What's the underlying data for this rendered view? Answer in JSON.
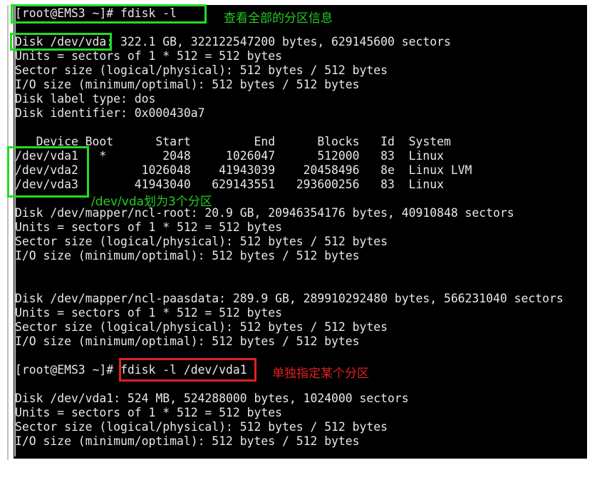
{
  "lines": [
    "[root@EMS3 ~]# fdisk -l",
    "",
    "Disk /dev/vda: 322.1 GB, 322122547200 bytes, 629145600 sectors",
    "Units = sectors of 1 * 512 = 512 bytes",
    "Sector size (logical/physical): 512 bytes / 512 bytes",
    "I/O size (minimum/optimal): 512 bytes / 512 bytes",
    "Disk label type: dos",
    "Disk identifier: 0x000430a7",
    "",
    "   Device Boot      Start         End      Blocks   Id  System",
    "/dev/vda1   *        2048     1026047      512000   83  Linux",
    "/dev/vda2         1026048    41943039    20458496   8e  Linux LVM",
    "/dev/vda3        41943040   629143551   293600256   83  Linux",
    "",
    "Disk /dev/mapper/ncl-root: 20.9 GB, 20946354176 bytes, 40910848 sectors",
    "Units = sectors of 1 * 512 = 512 bytes",
    "Sector size (logical/physical): 512 bytes / 512 bytes",
    "I/O size (minimum/optimal): 512 bytes / 512 bytes",
    "",
    "",
    "Disk /dev/mapper/ncl-paasdata: 289.9 GB, 289910292480 bytes, 566231040 sectors",
    "Units = sectors of 1 * 512 = 512 bytes",
    "Sector size (logical/physical): 512 bytes / 512 bytes",
    "I/O size (minimum/optimal): 512 bytes / 512 bytes",
    "",
    "[root@EMS3 ~]# fdisk -l /dev/vda1",
    "",
    "Disk /dev/vda1: 524 MB, 524288000 bytes, 1024000 sectors",
    "Units = sectors of 1 * 512 = 512 bytes",
    "Sector size (logical/physical): 512 bytes / 512 bytes",
    "I/O size (minimum/optimal): 512 bytes / 512 bytes"
  ],
  "annotations": {
    "view_all": "查看全部的分区信息",
    "vda_partitions": "/dev/vda划为3个分区",
    "single_partition": "单独指定某个分区"
  },
  "colors": {
    "terminal_bg": "#000000",
    "terminal_fg": "#e8e8e8",
    "highlight_green": "#22dd22",
    "highlight_red": "#e02020"
  }
}
